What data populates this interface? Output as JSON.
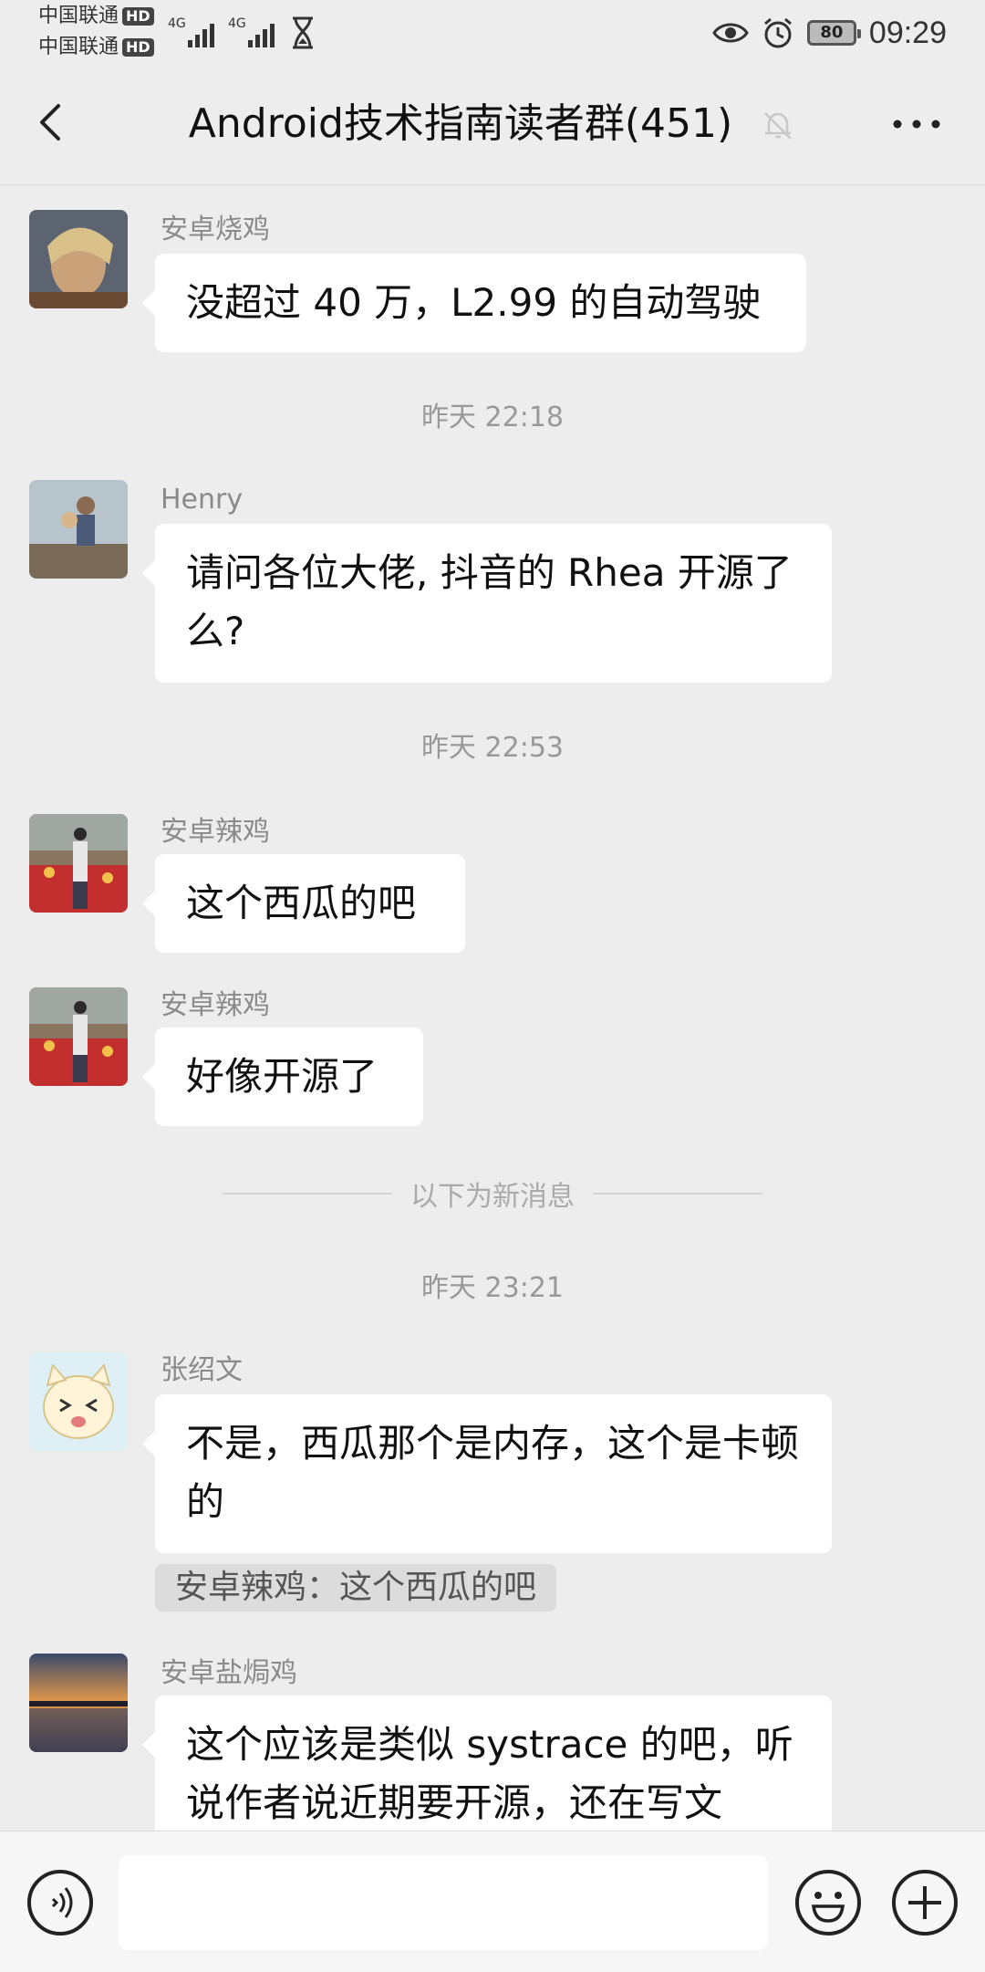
{
  "status_bar": {
    "carrier1": "中国联通",
    "carrier2": "中国联通",
    "hd": "HD",
    "network": "4G",
    "battery": "80",
    "time": "09:29"
  },
  "header": {
    "title": "Android技术指南读者群(451)"
  },
  "messages": [
    {
      "sender": "安卓烧鸡",
      "text": "没超过 40 万，L2.99 的自动驾驶"
    },
    {
      "sender": "Henry",
      "text": "请问各位大佬, 抖音的 Rhea 开源了么?"
    },
    {
      "sender": "安卓辣鸡",
      "text": "这个西瓜的吧"
    },
    {
      "sender": "安卓辣鸡",
      "text": "好像开源了"
    },
    {
      "sender": "张绍文",
      "text": "不是，西瓜那个是内存，这个是卡顿的",
      "quote": "安卓辣鸡：这个西瓜的吧"
    },
    {
      "sender": "安卓盐焗鸡",
      "text": "这个应该是类似 systrace 的吧，听说作者说近期要开源，还在写文"
    }
  ],
  "timestamps": [
    "昨天 22:18",
    "昨天 22:53",
    "昨天 23:21"
  ],
  "new_messages_divider": "以下为新消息",
  "input": {
    "value": ""
  },
  "icons": [
    "back-icon",
    "mute-bell-icon",
    "more-icon",
    "voice-icon",
    "emoji-icon",
    "plus-icon"
  ]
}
